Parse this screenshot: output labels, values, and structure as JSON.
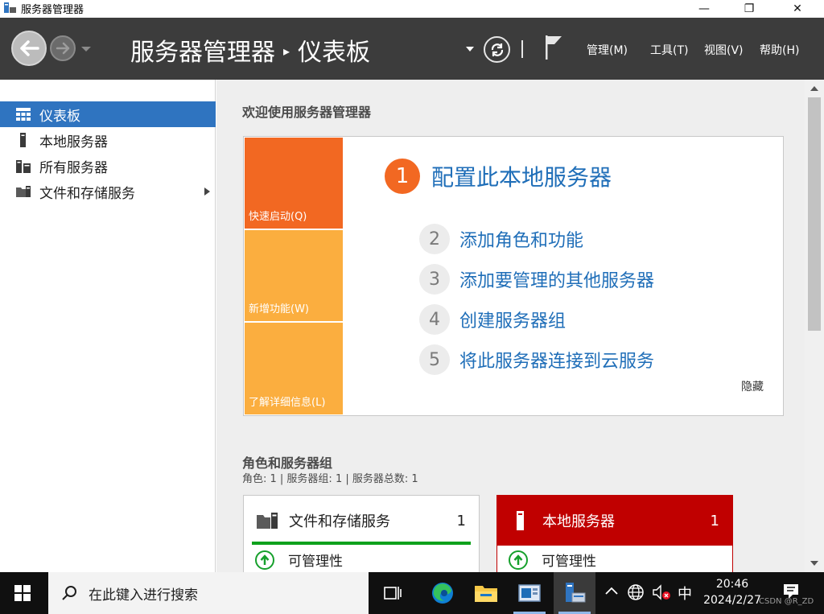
{
  "window": {
    "title": "服务器管理器",
    "controls": {
      "minimize": "—",
      "restore": "❐",
      "close": "✕"
    }
  },
  "header": {
    "breadcrumb_root": "服务器管理器",
    "breadcrumb_sep": "▸",
    "breadcrumb_current": "仪表板",
    "menus": [
      "管理(M)",
      "工具(T)",
      "视图(V)",
      "帮助(H)"
    ]
  },
  "sidebar": {
    "items": [
      {
        "label": "仪表板",
        "icon": "dashboard-icon",
        "active": true
      },
      {
        "label": "本地服务器",
        "icon": "server-icon",
        "active": false
      },
      {
        "label": "所有服务器",
        "icon": "servers-icon",
        "active": false
      },
      {
        "label": "文件和存储服务",
        "icon": "file-storage-icon",
        "active": false,
        "has_submenu": true
      }
    ]
  },
  "welcome": {
    "title": "欢迎使用服务器管理器",
    "tiles": [
      "快速启动(Q)",
      "新增功能(W)",
      "了解详细信息(L)"
    ],
    "main_step": {
      "number": "1",
      "label": "配置此本地服务器"
    },
    "steps": [
      {
        "number": "2",
        "label": "添加角色和功能"
      },
      {
        "number": "3",
        "label": "添加要管理的其他服务器"
      },
      {
        "number": "4",
        "label": "创建服务器组"
      },
      {
        "number": "5",
        "label": "将此服务器连接到云服务"
      }
    ],
    "hide_label": "隐藏"
  },
  "roles": {
    "title": "角色和服务器组",
    "summary": "角色: 1 | 服务器组: 1 | 服务器总数: 1",
    "cards": [
      {
        "name": "文件和存储服务",
        "count": "1",
        "status": "可管理性"
      },
      {
        "name": "本地服务器",
        "count": "1",
        "status": "可管理性"
      }
    ]
  },
  "taskbar": {
    "search_placeholder": "在此键入进行搜索",
    "ime": "中",
    "time": "20:46",
    "date": "2024/2/27",
    "watermark": "CSDN @R_ZD"
  },
  "colors": {
    "header_bg": "#3c3c3c",
    "accent_blue": "#2f74c0",
    "quick_start_orange": "#f26822",
    "tile_yellow": "#fbae3f",
    "local_server_red": "#c00000",
    "ok_green": "#16a02c"
  }
}
